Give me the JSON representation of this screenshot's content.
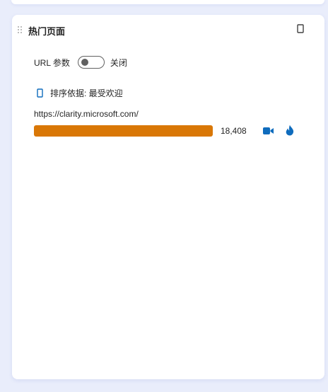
{
  "widget": {
    "title": "热门页面"
  },
  "url_params": {
    "label": "URL 参数",
    "toggle_on": false,
    "toggle_state_text": "关闭"
  },
  "sort": {
    "label": "排序依据: 最受欢迎"
  },
  "pages": [
    {
      "url": "https://clarity.microsoft.com/",
      "count": "18,408",
      "share": 1.0
    }
  ],
  "colors": {
    "bar": "#d97706",
    "accent": "#0f6cbd"
  },
  "icons": {
    "drag": "drag-handle-icon",
    "menu": "more-options-icon",
    "sort": "sort-icon",
    "recordings": "video-camera-icon",
    "heatmaps": "flame-icon"
  }
}
